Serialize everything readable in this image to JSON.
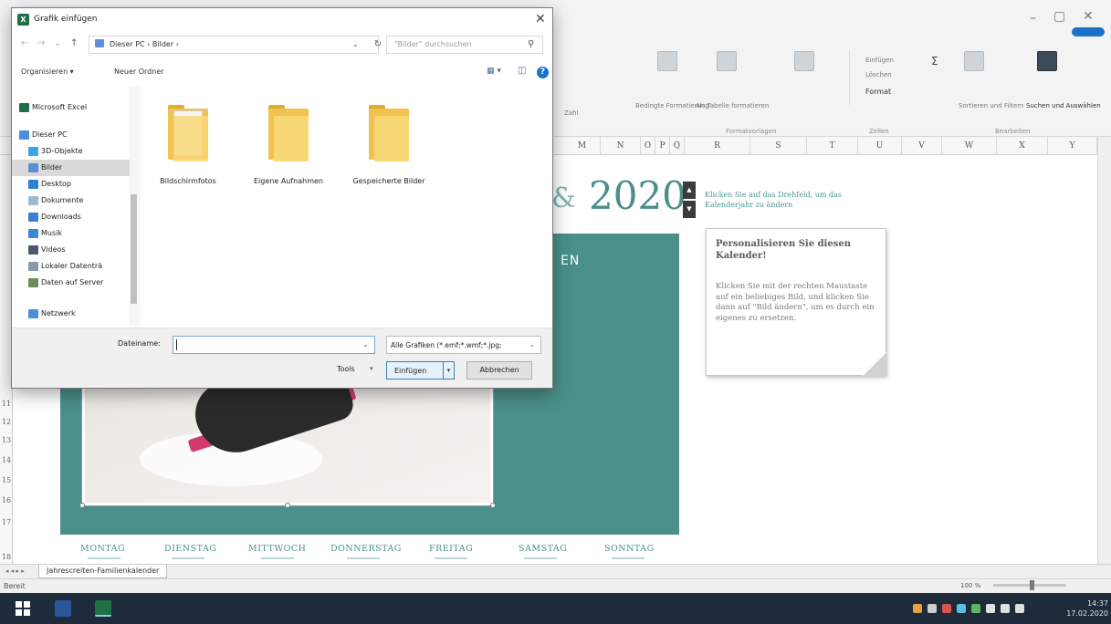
{
  "colors": {
    "teal": "#4a8f8a",
    "excel_green": "#1e7145",
    "folder_yellow": "#f8d775",
    "taskbar": "#1d2b3a"
  },
  "excel": {
    "window_controls": [
      "–",
      "▢",
      "✕"
    ],
    "ribbon": {
      "format_group_items": [
        "Bedingte Formatierung",
        "Als Tabelle formatieren",
        "Zellenformatvorlagen"
      ],
      "format_group_label": "Formatvorlagen",
      "cells_items": [
        "Einfügen",
        "Löschen",
        "Format"
      ],
      "cells_group_label": "Zellen",
      "edit_items": [
        "Sortieren und Filtern",
        "Suchen und Auswählen"
      ],
      "edit_group_label": "Bearbeiten",
      "zahl_label": "Zahl"
    },
    "columns": [
      "M",
      "N",
      "O",
      "P",
      "Q",
      "R",
      "S",
      "T",
      "U",
      "V",
      "W",
      "X",
      "Y"
    ],
    "rows": [
      "11",
      "12",
      "13",
      "14",
      "15",
      "16",
      "17",
      "18"
    ],
    "calendar": {
      "year": "2020",
      "year_prefix": "&",
      "year_hint": "Klicken Sie auf das Drehfeld, um das Kalenderjahr zu ändern",
      "panel_partial_text": "EN",
      "note_title": "Personalisieren Sie diesen Kalender!",
      "note_body": "Klicken Sie mit der rechten Maustaste auf ein beliebiges Bild, und klicken Sie dann auf \"Bild ändern\", um es durch ein eigenes zu ersetzen.",
      "weekdays": [
        "MONTAG",
        "DIENSTAG",
        "MITTWOCH",
        "DONNERSTAG",
        "FREITAG",
        "SAMSTAG",
        "SONNTAG"
      ]
    },
    "sheet_tab": "Jahrescreiten-Familienkalender",
    "sheet_nav": "◂ ◂ ▸ ▸",
    "status": "Bereit",
    "zoom": "100 %",
    "clock_time": "14:37",
    "clock_date": "17.02.2020"
  },
  "dialog": {
    "title": "Grafik einfügen",
    "close": "✕",
    "address": "Dieser PC  ›  Bilder  ›",
    "search_placeholder": "\"Bilder\" durchsuchen",
    "organize": "Organisieren ▾",
    "new_folder": "Neuer Ordner",
    "nav_items": [
      {
        "label": "Microsoft Excel",
        "icon": "excel-icon"
      },
      {
        "label": "Dieser PC",
        "icon": "computer-icon"
      },
      {
        "label": "3D-Objekte",
        "icon": "cube-icon"
      },
      {
        "label": "Bilder",
        "icon": "pictures-icon"
      },
      {
        "label": "Desktop",
        "icon": "desktop-icon"
      },
      {
        "label": "Dokumente",
        "icon": "documents-icon"
      },
      {
        "label": "Downloads",
        "icon": "download-icon"
      },
      {
        "label": "Musik",
        "icon": "music-icon"
      },
      {
        "label": "Videos",
        "icon": "video-icon"
      },
      {
        "label": "Lokaler Datenträ",
        "icon": "drive-icon"
      },
      {
        "label": "Daten auf Server",
        "icon": "network-drive-icon"
      },
      {
        "label": "Netzwerk",
        "icon": "network-icon"
      }
    ],
    "folders": [
      "Bildschirmfotos",
      "Eigene Aufnahmen",
      "Gespeicherte Bilder"
    ],
    "filename_label": "Dateiname:",
    "filename_value": "",
    "filetype": "Alle Grafiken (*.emf;*.wmf;*.jpg;",
    "tools": "Tools",
    "insert": "Einfügen",
    "cancel": "Abbrechen"
  }
}
